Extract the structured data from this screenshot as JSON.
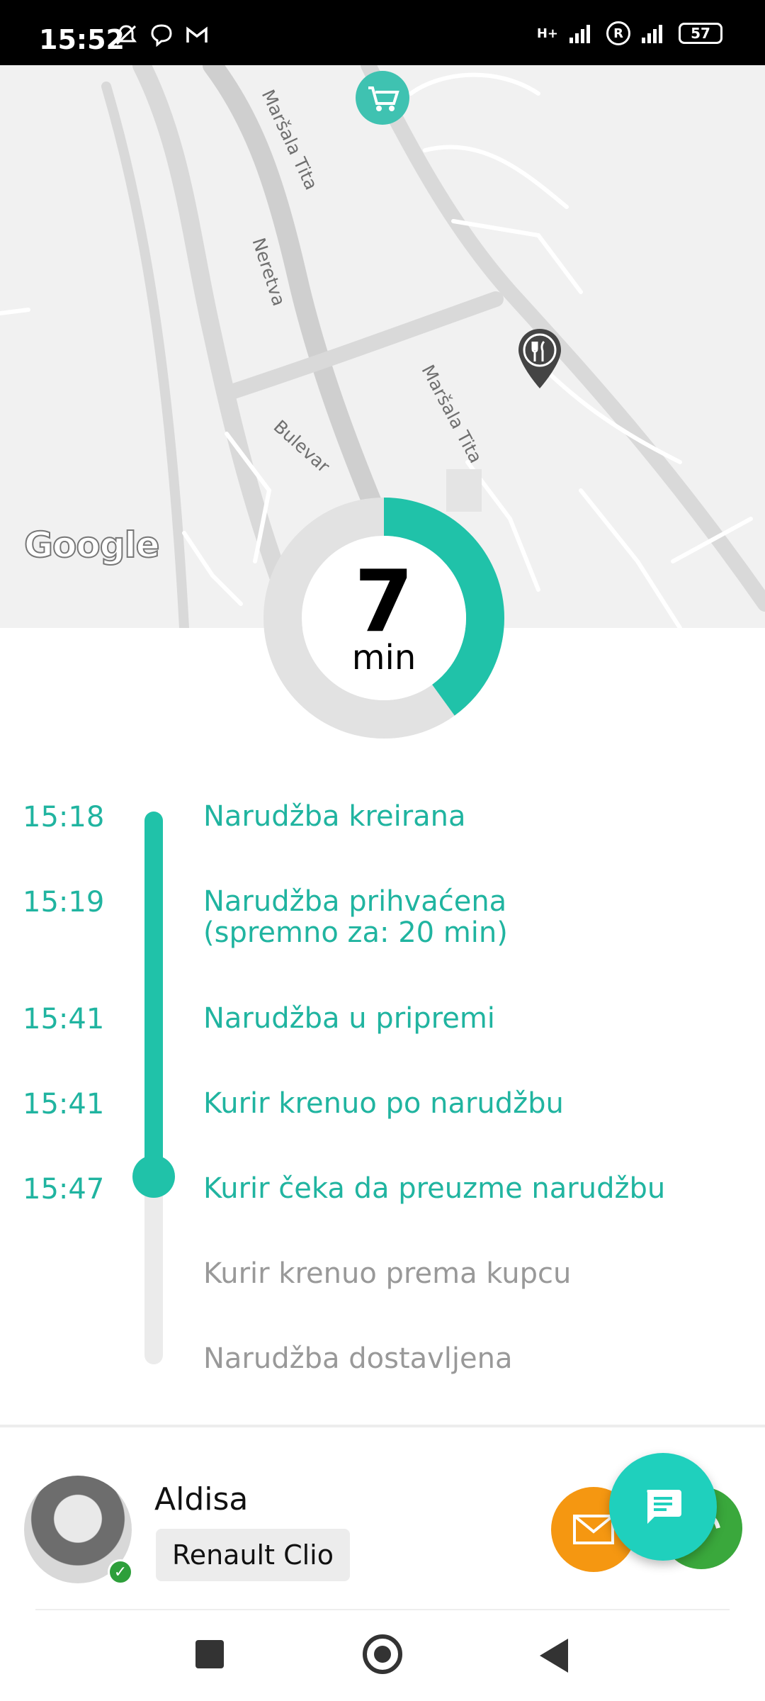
{
  "status_bar": {
    "time": "15:52",
    "network": "H+",
    "roaming": "R",
    "battery": "57"
  },
  "map": {
    "provider": "Google",
    "road_labels": [
      "Maršala Tita",
      "Neretva",
      "Bulevar",
      "Maršala Tita"
    ],
    "markers": [
      "cart-icon",
      "restaurant-pin-icon"
    ]
  },
  "eta": {
    "value": "7",
    "unit": "min",
    "progress_fraction": 0.4
  },
  "timeline": [
    {
      "time": "15:18",
      "label": "Narudžba kreirana",
      "done": true
    },
    {
      "time": "15:19",
      "label": "Narudžba prihvaćena\n(spremno za: 20 min)",
      "done": true
    },
    {
      "time": "15:41",
      "label": "Narudžba u pripremi",
      "done": true
    },
    {
      "time": "15:41",
      "label": "Kurir krenuo po narudžbu",
      "done": true
    },
    {
      "time": "15:47",
      "label": "Kurir čeka da preuzme narudžbu",
      "done": true
    },
    {
      "time": "",
      "label": "Kurir krenuo prema kupcu",
      "done": false
    },
    {
      "time": "",
      "label": "Narudžba dostavljena",
      "done": false
    }
  ],
  "courier": {
    "name": "Aldisa",
    "vehicle": "Renault Clio"
  },
  "colors": {
    "accent": "#20c2a9",
    "pending": "#999999",
    "mail": "#f59711",
    "call": "#3aa83c",
    "chat": "#1fd0bd"
  }
}
